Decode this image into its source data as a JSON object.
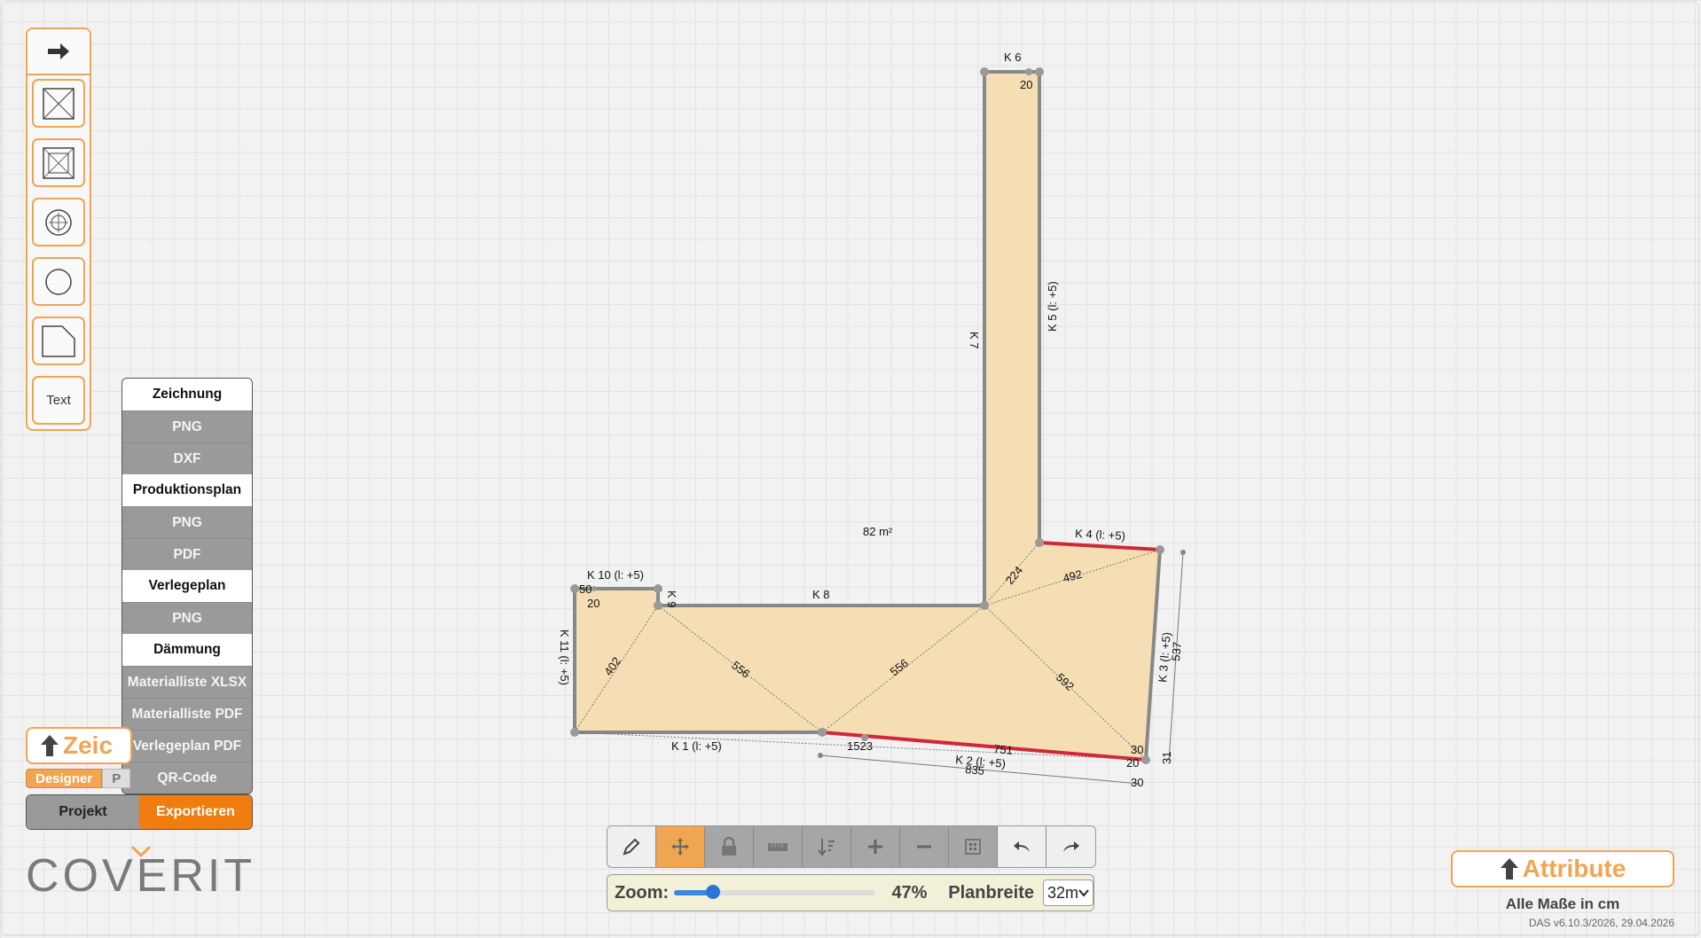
{
  "toolbar": {
    "tools": [
      "arrow-tool",
      "rectangle-cross-tool",
      "inner-rectangle-tool",
      "circle-target-tool",
      "circle-tool",
      "polygon-tool"
    ],
    "text_tool_label": "Text"
  },
  "export_menu": {
    "sections": [
      {
        "title": "Zeichnung",
        "items": [
          "PNG",
          "DXF"
        ]
      },
      {
        "title": "Produktionsplan",
        "items": [
          "PNG",
          "PDF"
        ]
      },
      {
        "title": "Verlegeplan",
        "items": [
          "PNG"
        ]
      },
      {
        "title": "Dämmung",
        "items": [
          "Materialliste XLSX",
          "Materialliste PDF",
          "Verlegeplan PDF",
          "QR-Code"
        ]
      }
    ]
  },
  "left_panel": {
    "zeich_label": "Zeic",
    "mode_tabs": [
      "Designer",
      "P"
    ],
    "projekt_label": "Projekt",
    "export_label": "Exportieren",
    "logo": "COVERIT"
  },
  "plan": {
    "area_label": "82 m²",
    "edges": {
      "k1": "K 1 (l: +5)",
      "k2": "K 2 (l: +5)",
      "k3": "K 3 (l: +5)",
      "k4": "K 4 (l: +5)",
      "k5": "K 5 (l: +5)",
      "k6": "K 6",
      "k7": "K 7",
      "k8": "K 8",
      "k9": "K 9",
      "k10": "K 10 (l: +5)",
      "k11": "K 11 (l: +5)"
    },
    "dimensions": {
      "d402": "402",
      "d556a": "556",
      "d556b": "556",
      "d592": "592",
      "d224": "224",
      "d492": "492",
      "d1523": "1523",
      "d751": "751",
      "d835": "835",
      "d537": "537",
      "d30a": "30",
      "d30b": "30",
      "d31": "31",
      "d20a": "20",
      "d20b": "20",
      "d20c": "20",
      "d50": "50"
    }
  },
  "bottom_toolbar": {
    "buttons": [
      "pencil-icon",
      "move-icon",
      "lock-icon",
      "ruler-icon",
      "sort-icon",
      "plus-icon",
      "minus-icon",
      "grid-icon",
      "undo-icon",
      "redo-icon"
    ]
  },
  "zoom": {
    "label": "Zoom:",
    "value_text": "47%",
    "value": 0.47,
    "plan_width_label": "Planbreite",
    "plan_width_value": "32m"
  },
  "right_panel": {
    "attribute_label": "Attribute",
    "units_label": "Alle Maße in cm",
    "version": "DAS v6.10.3/2026, 29.04.2026"
  },
  "colors": {
    "accent": "#f0a552",
    "export_active": "#f07d10",
    "plan_fill": "#f5deb3",
    "edge_highlight": "#d0283a"
  }
}
